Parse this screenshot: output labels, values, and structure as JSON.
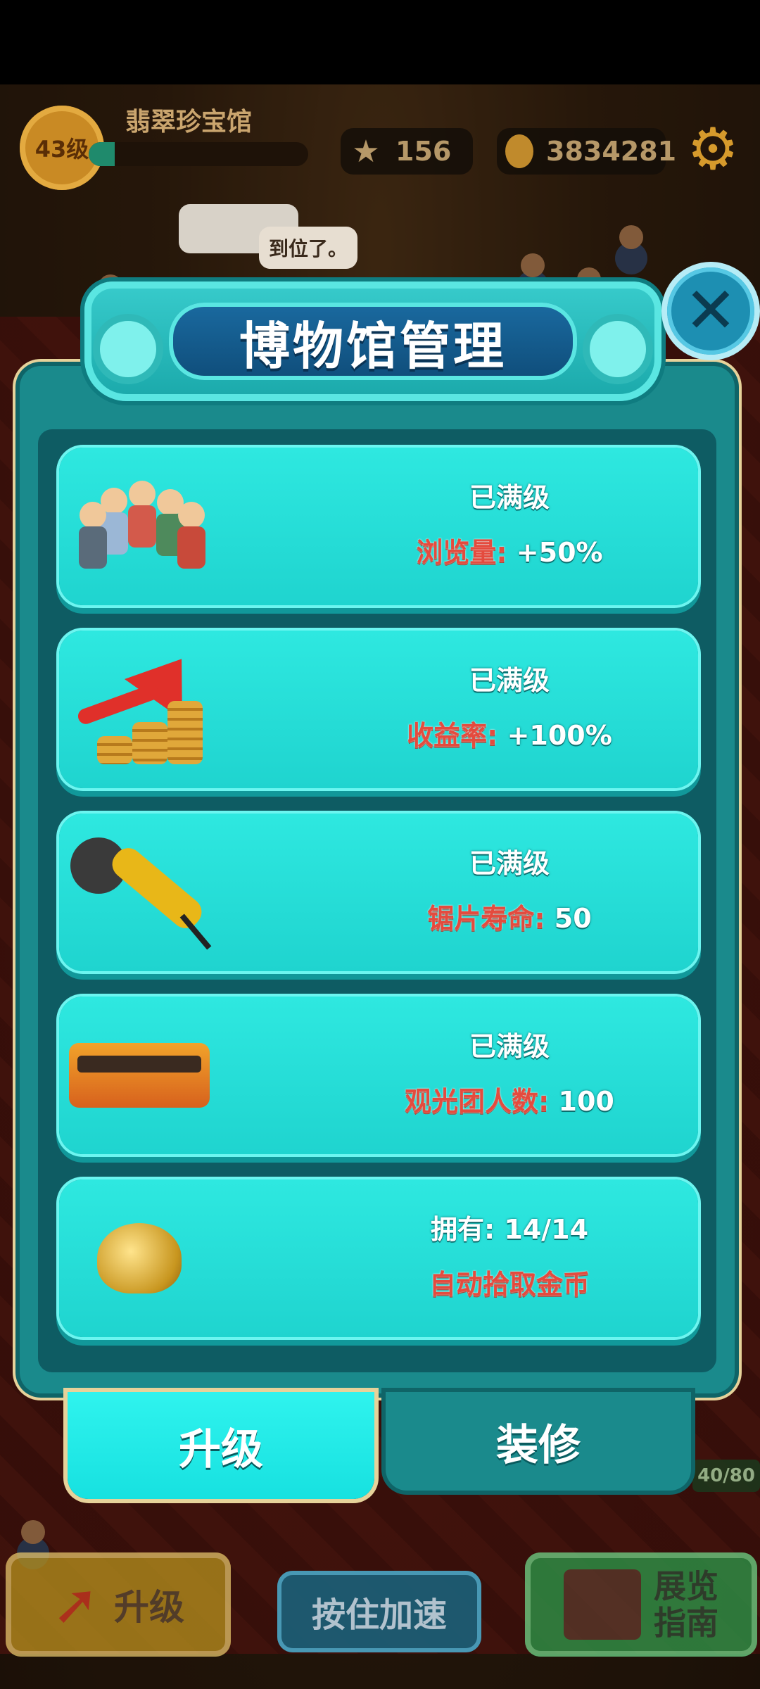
{
  "hud": {
    "level": "43级",
    "museum_name": "翡翠珍宝馆",
    "xp_progress": 0.12,
    "stars": "156",
    "coins": "3834281"
  },
  "speech_bubble": "到位了。",
  "modal": {
    "title": "博物馆管理",
    "cards": [
      {
        "line1": "已满级",
        "label": "浏览量:",
        "value": " +50%"
      },
      {
        "line1": "已满级",
        "label": "收益率:",
        "value": " +100%"
      },
      {
        "line1": "已满级",
        "label": "锯片寿命:",
        "value": " 50"
      },
      {
        "line1": "已满级",
        "label": "观光团人数:",
        "value": " 100"
      },
      {
        "line1": "拥有: 14/14",
        "full_line": "自动拾取金币"
      }
    ],
    "tabs": {
      "upgrade": "升级",
      "decorate": "装修"
    }
  },
  "bottom": {
    "upgrade_label": "升级",
    "speed_label": "按住加速",
    "guide_label_1": "展览",
    "guide_label_2": "指南",
    "capacity": "40/80"
  },
  "colors": {
    "card_teal": "#1fd4cf",
    "label_red": "#e44b3e",
    "modal_teal": "#1a8a8c"
  }
}
